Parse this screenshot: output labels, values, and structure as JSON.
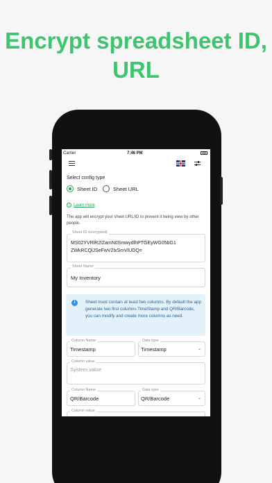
{
  "headline": "Encrypt spreadsheet ID, URL",
  "status_bar": {
    "carrier": "Carrier",
    "time": "7:46 PM"
  },
  "config": {
    "title": "Select config type",
    "options": [
      {
        "label": "Sheet ID",
        "selected": true
      },
      {
        "label": "Sheet URL",
        "selected": false
      }
    ],
    "learn_more": "Learn more",
    "description": "The app will encrypt your sheet URL/ID to prevent it being view by other people."
  },
  "sheet_id": {
    "label": "Sheet ID (encrypted)",
    "value_line1": "MS02YVRlR2lZamN0SmwydlhPTGEyWG05bG1",
    "value_line2": "ZWkRCQlJSeFwV2lxSmVlUDQ="
  },
  "sheet_name": {
    "label": "Sheet Name",
    "value": "My Inventory"
  },
  "alert": {
    "text": "Sheet must contain at least two columns. By default the app generate two first columns TimeStamp and QR/Barcode, you can modify and create more columns as need."
  },
  "columns": [
    {
      "name_label": "Column Name",
      "name": "Timestamp",
      "type_label": "Data type",
      "type": "Timestamp",
      "value_label": "Column value",
      "value_placeholder": "System value"
    },
    {
      "name_label": "Column Name",
      "name": "QR/Barcode",
      "type_label": "Data type",
      "type": "QR/Barcode",
      "value_label": "Column value",
      "value_placeholder": ""
    }
  ],
  "colors": {
    "headline": "#3dc46f",
    "accent": "#22a559",
    "alert_bg": "#e3f1fb",
    "alert_text": "#2c5f8a"
  },
  "icons": {
    "menu": "menu-icon",
    "flag": "uk-flag-icon",
    "settings": "tune-icon",
    "info": "info-icon",
    "dropdown": "chevron-down-icon"
  }
}
